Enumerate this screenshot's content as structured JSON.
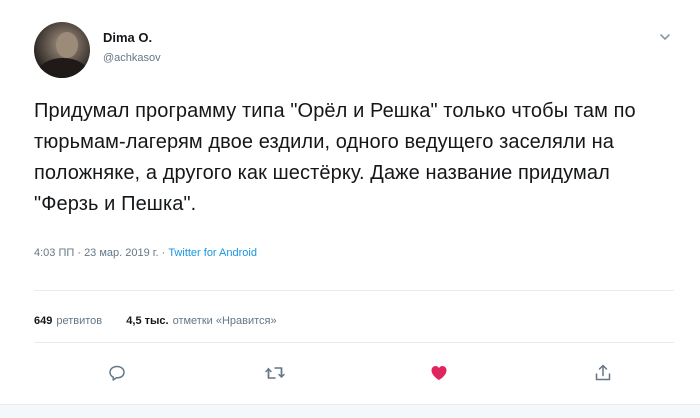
{
  "tweet": {
    "user": {
      "name": "Dima O.",
      "handle": "@achkasov"
    },
    "text": "Придумал программу типа \"Орёл и Решка\" только чтобы там по тюрьмам-лагерям двое ездили, одного ведущего заселяли на положняке, а другого как шестёрку. Даже название придумал \"Ферзь и Пешка\".",
    "time": "4:03 ПП",
    "separator": " · ",
    "date": "23 мар. 2019 г.",
    "source": "Twitter for Android",
    "retweets_count": "649",
    "retweets_label": "ретвитов",
    "likes_count": "4,5 тыс.",
    "likes_label": "отметки «Нравится»",
    "icons": {
      "reply": "reply-icon",
      "retweet": "retweet-icon",
      "like": "heart-icon",
      "share": "share-icon",
      "menu": "chevron-down-icon"
    },
    "colors": {
      "like": "#e0245e",
      "icon": "#657786",
      "link": "#1b95e0"
    }
  }
}
